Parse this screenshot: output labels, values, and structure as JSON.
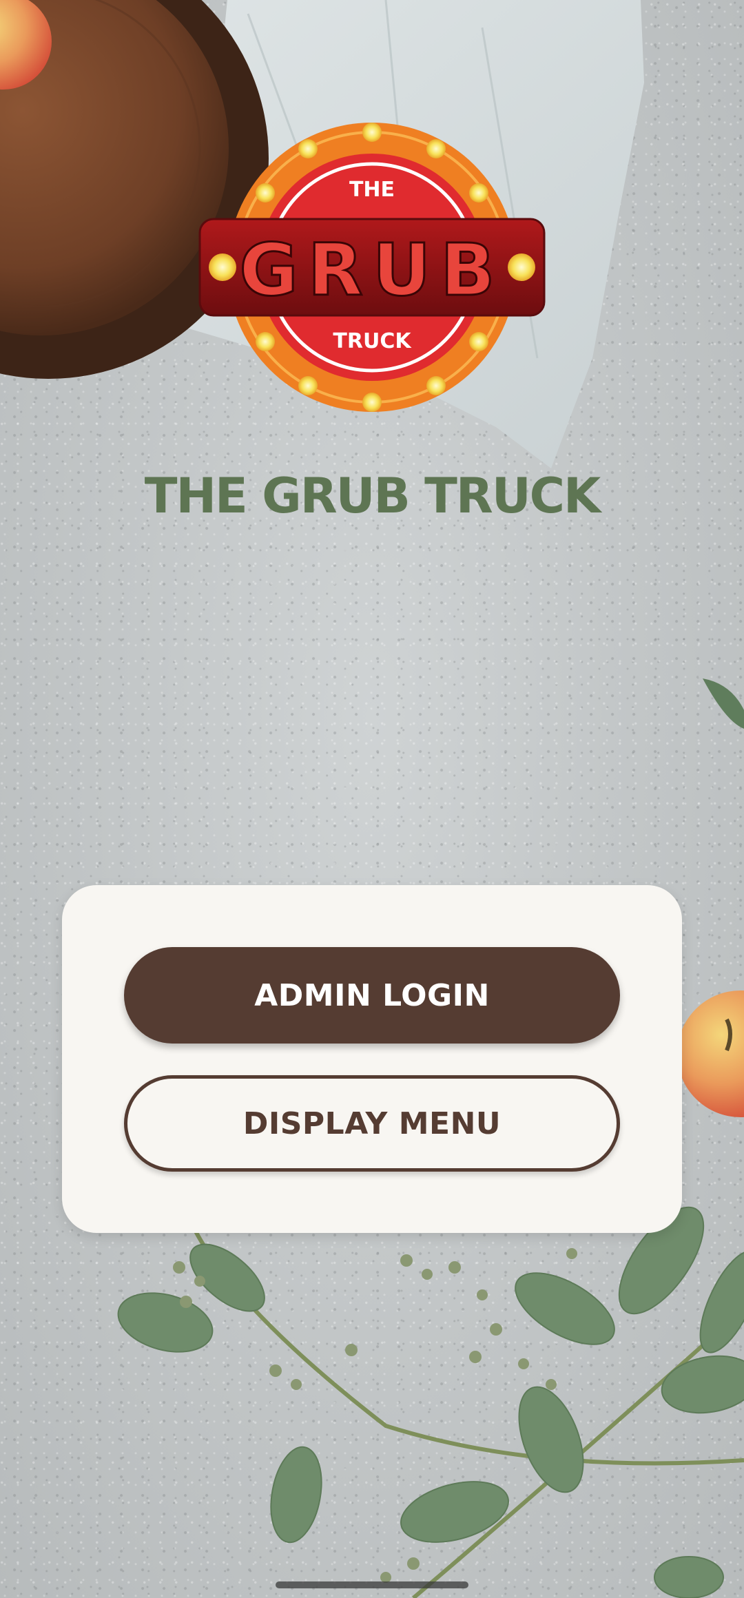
{
  "app": {
    "title": "THE GRUB TRUCK",
    "logo": {
      "top_text": "THE",
      "main_text": "GRUB",
      "bottom_text": "TRUCK"
    }
  },
  "actions": {
    "admin_login_label": "ADMIN LOGIN",
    "display_menu_label": "DISPLAY MENU"
  },
  "colors": {
    "title_green": "#5e7553",
    "primary_brown": "#553c32",
    "card_background": "#f8f6f2"
  }
}
